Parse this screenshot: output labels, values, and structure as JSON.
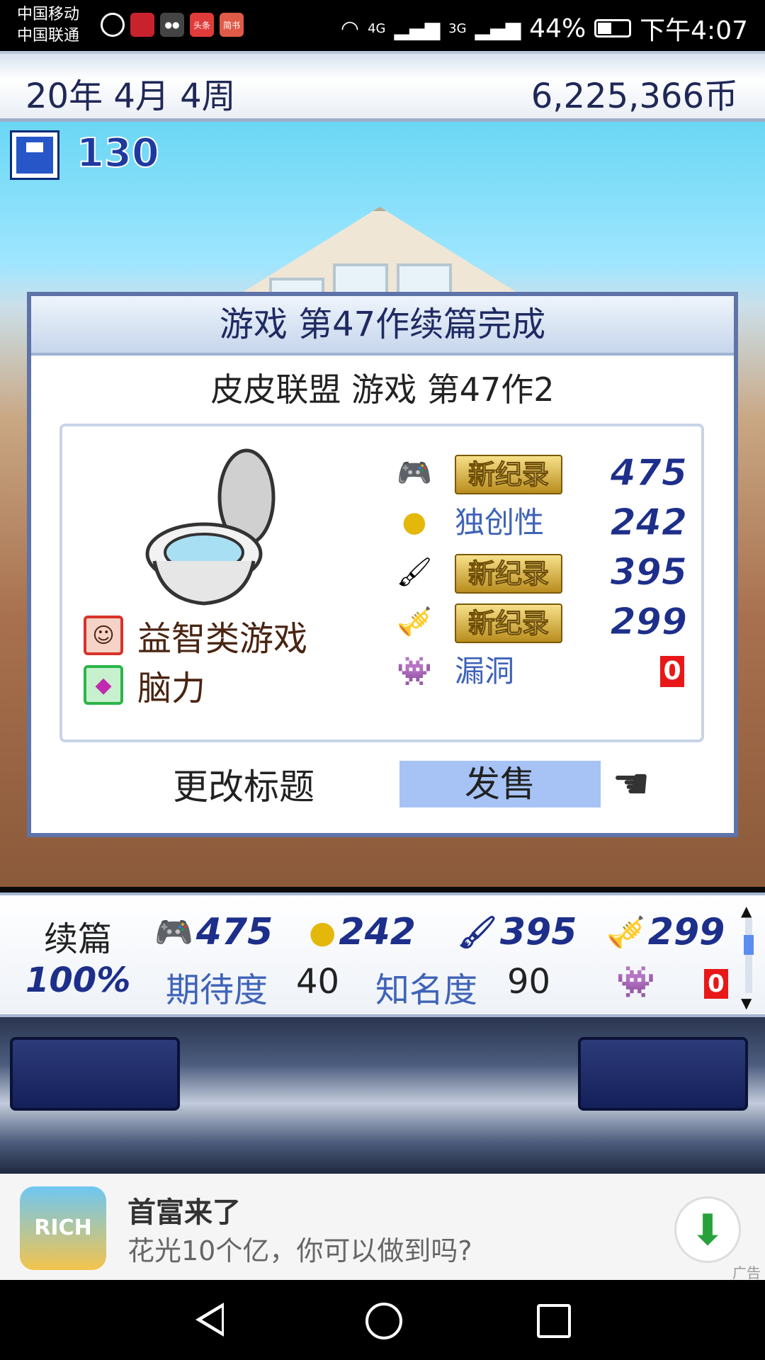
{
  "status_bar": {
    "carrier1": "中国移动",
    "carrier2": "中国联通",
    "app_icons": [
      "timer-icon",
      "book-app-icon",
      "wechat-icon",
      "toutiao-icon",
      "jianshu-icon"
    ],
    "app_labels": {
      "toutiao": "头条",
      "jianshu": "简书"
    },
    "signal_labels": [
      "4G",
      "3G"
    ],
    "battery": "44%",
    "battery_level": 0.44,
    "time": "下午4:07"
  },
  "game": {
    "date": "20年 4月 4周",
    "coins": "6,225,366币",
    "save_count": "130",
    "dialog": {
      "title": "游戏 第47作续篇完成",
      "subtitle": "皮皮联盟 游戏 第47作2",
      "genre": "益智类游戏",
      "type": "脑力",
      "stats": [
        {
          "icon": "controller-icon",
          "badge": "新纪录",
          "value": "475"
        },
        {
          "icon": "gold-coin-icon",
          "label": "独创性",
          "value": "242"
        },
        {
          "icon": "paint-brush-icon",
          "badge": "新纪录",
          "value": "395"
        },
        {
          "icon": "trumpet-icon",
          "badge": "新纪录",
          "value": "299"
        },
        {
          "icon": "bug-icon",
          "label": "漏洞",
          "value": "0"
        }
      ],
      "rename_label": "更改标题",
      "sell_label": "发售"
    },
    "info": {
      "label": "续篇",
      "percent": "100%",
      "fun": "475",
      "originality": "242",
      "graphics": "395",
      "sound": "299",
      "expect_label": "期待度",
      "expect_value": "40",
      "fame_label": "知名度",
      "fame_value": "90",
      "bugs": "0"
    }
  },
  "ad": {
    "icon_text": "RICH",
    "title": "首富来了",
    "desc": "花光10个亿，你可以做到吗?",
    "tag": "广告"
  },
  "colors": {
    "dialog_border": "#5e73a8",
    "sell_highlight": "#a7c3f6",
    "stat_blue": "#1d2f8a",
    "record_gold": "#d8b23a",
    "bug_red": "#e81818"
  }
}
